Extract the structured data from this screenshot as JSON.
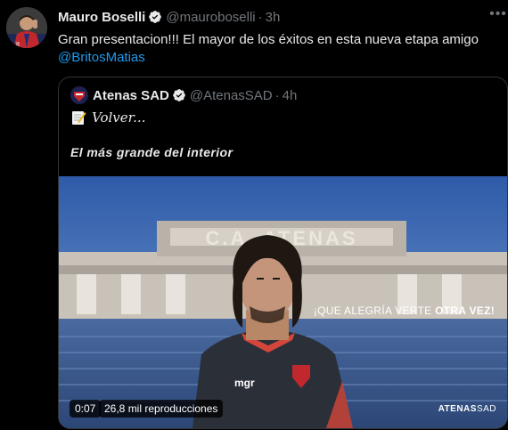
{
  "tweet": {
    "author_name": "Mauro Boselli",
    "author_handle": "@mauroboselli",
    "separator": "·",
    "time": "3h",
    "text": "Gran presentacion!!! El mayor de los éxitos en esta nueva etapa amigo",
    "mention": "@BritosMatias",
    "more_icon": "more-horizontal-icon",
    "verified_color": "#1d9bf0"
  },
  "quote": {
    "author_name": "Atenas SAD",
    "author_handle": "@AtenasSAD",
    "separator": "·",
    "time": "4h",
    "line1": "Volver...",
    "line2": "El más grande del interior",
    "media": {
      "overlay_prefix": "¡QUE ALEGRÍA VERTE",
      "overlay_bold": "OTRA VEZ!",
      "stadium_sign": "C.A. ATENAS",
      "shirt_sponsor": "mgr",
      "duration": "0:07",
      "views": "26,8 mil reproducciones",
      "watermark_bold": "ATENAS",
      "watermark_light": "SAD"
    }
  },
  "colors": {
    "background": "#000000",
    "text_primary": "#e7e9ea",
    "text_secondary": "#71767b",
    "link": "#1d9bf0",
    "border": "#2f3336"
  }
}
